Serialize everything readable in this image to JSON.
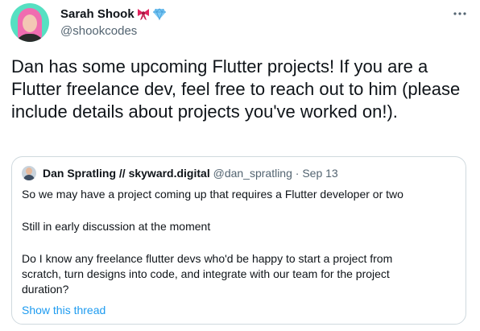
{
  "author": {
    "name": "Sarah Shook",
    "handle": "@shookcodes",
    "avatar_icon": "profile-photo",
    "badges": [
      "ribbon-bow-icon",
      "gem-icon"
    ]
  },
  "tweet": {
    "text": "Dan has some upcoming Flutter projects! If you are a Flutter freelance dev, feel free to reach out to him (please include details about projects you've worked on!)."
  },
  "quote": {
    "name": "Dan Spratling // skyward.digital",
    "handle": "@dan_spratling",
    "separator": "·",
    "date": "Sep 13",
    "lines": [
      "So we may have a project coming up that requires a Flutter developer or two",
      "Still in early discussion at the moment",
      "Do I know any freelance flutter devs who'd be happy to start a project from",
      "scratch, turn designs into code, and integrate with our team for the project",
      "duration?"
    ],
    "show_thread_label": "Show this thread"
  },
  "colors": {
    "text": "#0f1419",
    "secondary": "#536471",
    "link": "#1d9bf0",
    "border": "#cfd9de"
  }
}
